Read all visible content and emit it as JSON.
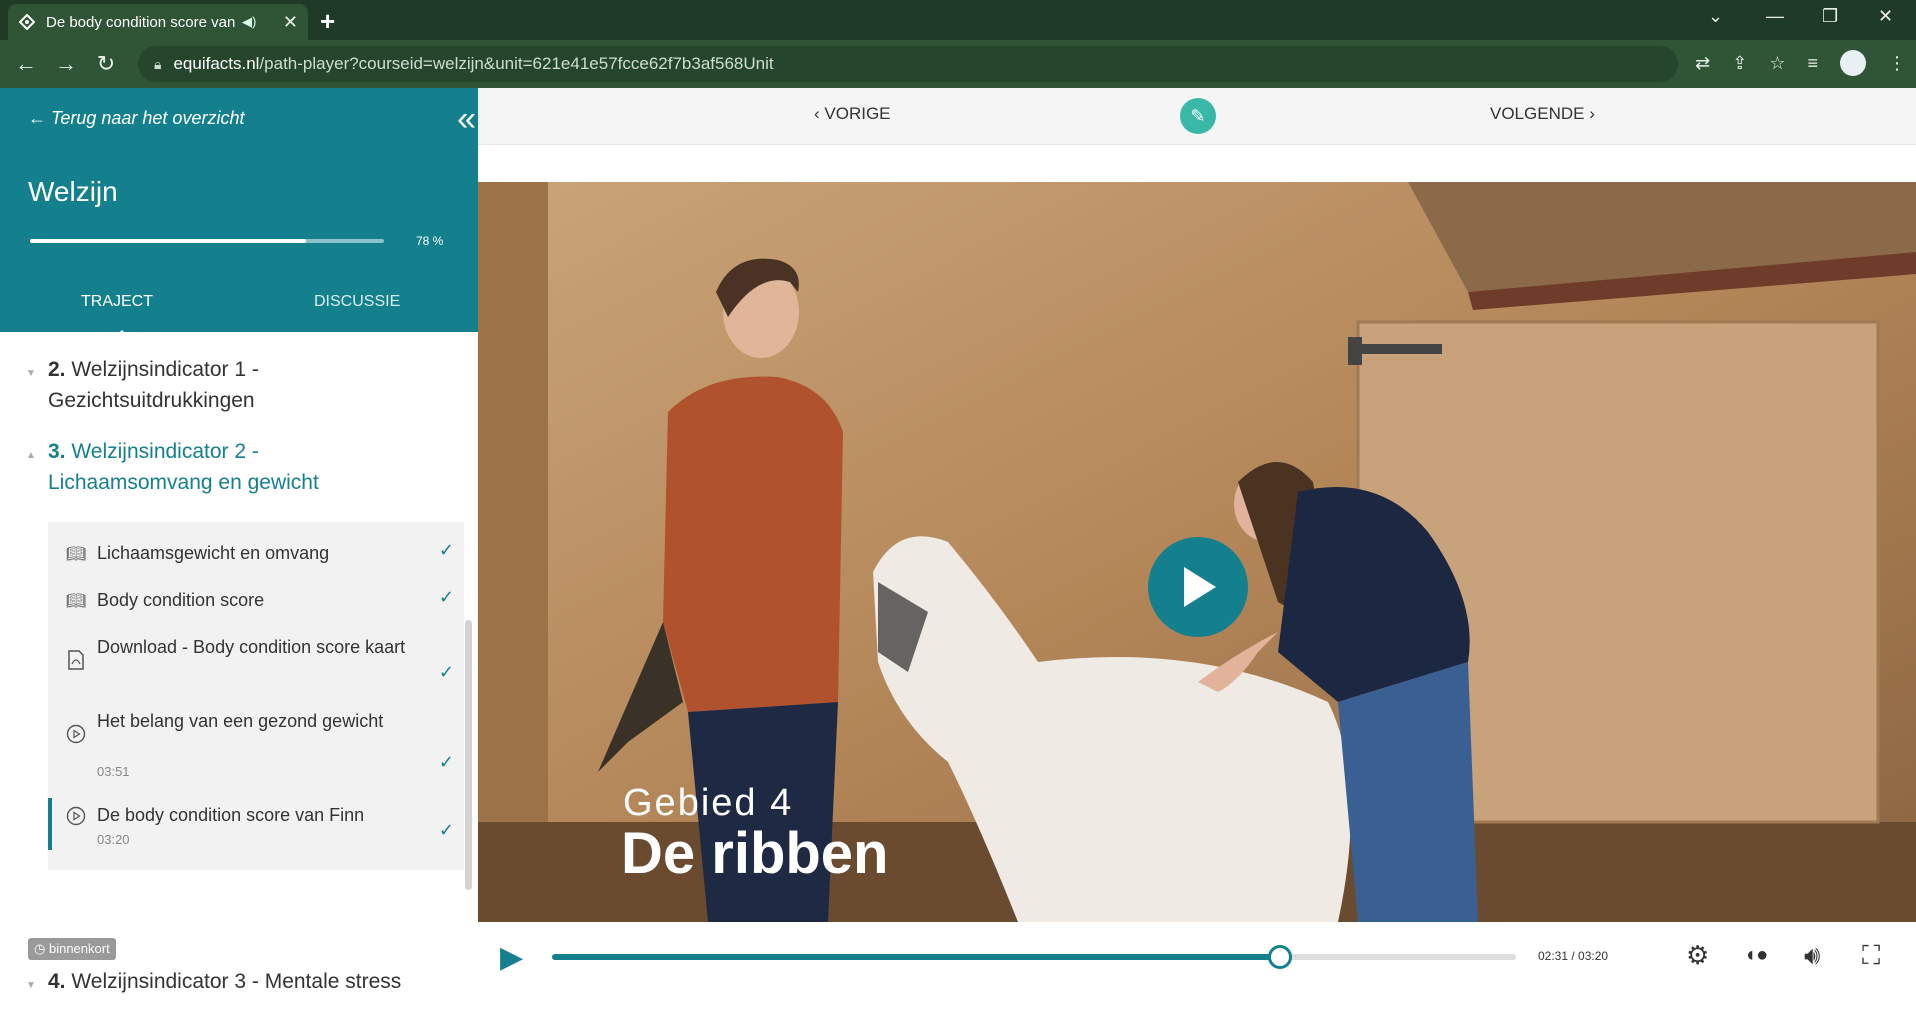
{
  "browser": {
    "tab_title": "De body condition score van Finn",
    "url_host": "equifacts.nl",
    "url_path": "/path-player?courseid=welzijn&unit=621e41e57fcce62f7b3af568Unit"
  },
  "sidebar": {
    "back_label": "Terug naar het overzicht",
    "course_title": "Welzijn",
    "progress": 0.78,
    "progress_label": "78 %",
    "tabs": [
      {
        "label": "TRAJECT",
        "active": true
      },
      {
        "label": "DISCUSSIE",
        "active": false
      }
    ],
    "chapters": [
      {
        "number": "2.",
        "title": "Welzijnsindicator 1 - Gezichtsuitdrukkingen"
      },
      {
        "number": "3.",
        "title": "Welzijnsindicator 2 - Lichaamsomvang en gewicht"
      },
      {
        "number": "4.",
        "title": "Welzijnsindicator 3 - Mentale stress"
      }
    ],
    "units": [
      {
        "icon": "book-icon",
        "label": "Lichaamsgewicht en omvang",
        "duration": "",
        "done": true
      },
      {
        "icon": "book-icon",
        "label": "Body condition score",
        "duration": "",
        "done": true
      },
      {
        "icon": "pdf-icon",
        "label": "Download - Body condition score kaart",
        "duration": "",
        "done": true
      },
      {
        "icon": "video-icon",
        "label": "Het belang van een gezond gewicht",
        "duration": "03:51",
        "done": true
      },
      {
        "icon": "video-icon",
        "label": "De body condition score van Finn",
        "duration": "03:20",
        "done": true
      }
    ],
    "soon_badge": "binnenkort"
  },
  "main": {
    "prev_label": "VORIGE",
    "next_label": "VOLGENDE"
  },
  "video": {
    "overlay_small": "Gebied 4",
    "overlay_big": "De ribben",
    "progress": 0.755,
    "time_label": "02:31 / 03:20"
  },
  "colors": {
    "accent": "#15808d",
    "chrome": "#2f5536"
  }
}
